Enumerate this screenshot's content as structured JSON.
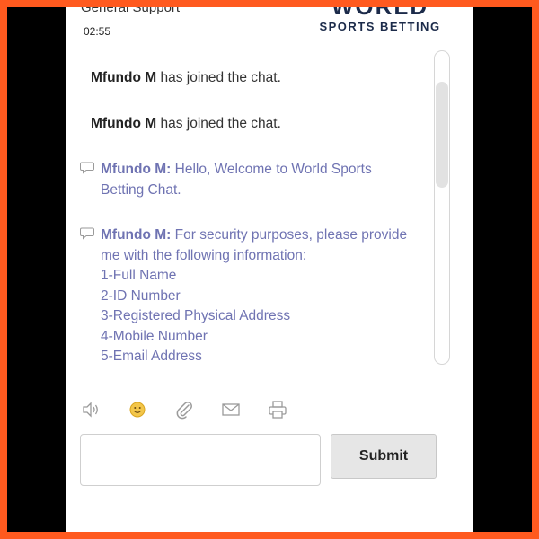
{
  "header": {
    "title": "General Support",
    "timer": "02:55"
  },
  "logo": {
    "top_text": "WORLD",
    "bottom_text": "SPORTS BETTING"
  },
  "messages": {
    "system": [
      {
        "name": "Mfundo M",
        "text": " has joined the chat."
      },
      {
        "name": "Mfundo M",
        "text": " has joined the chat."
      }
    ],
    "agent": [
      {
        "name": "Mfundo M:",
        "lines": [
          "Hello, Welcome to World Sports",
          "Betting Chat."
        ]
      },
      {
        "name": "Mfundo M:",
        "lines": [
          "For security purposes, please provide",
          "me with the following information:",
          "1-Full Name",
          "2-ID Number",
          "3-Registered Physical Address",
          "4-Mobile Number",
          "5-Email Address"
        ]
      }
    ]
  },
  "toolbar": {
    "icons": [
      "speaker-icon",
      "emoji-icon",
      "attachment-icon",
      "email-icon",
      "print-icon"
    ]
  },
  "composer": {
    "input_value": "",
    "submit_label": "Submit"
  },
  "colors": {
    "outer_border": "#ff5a1f",
    "agent_text": "#6f73b2",
    "logo_navy": "#1c2b4a",
    "logo_accent": "#3a7bd5"
  }
}
